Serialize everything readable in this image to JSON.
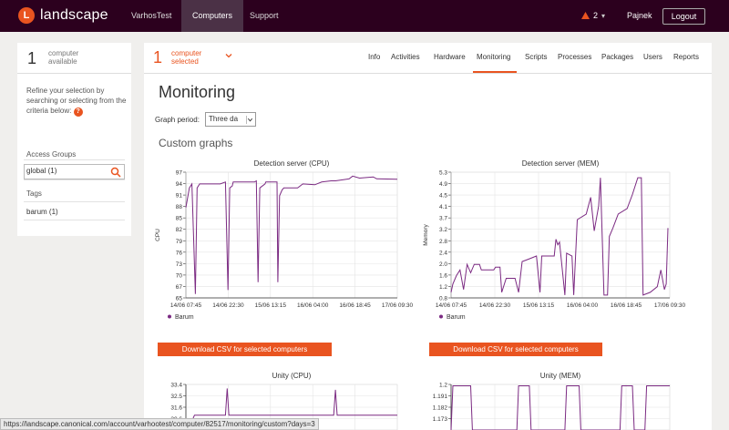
{
  "topbar": {
    "logo_letter": "L",
    "brand": "landscape",
    "nav": [
      "VarhosTest",
      "Computers",
      "Support"
    ],
    "alert_count": "2",
    "username": "Pajnek",
    "logout_label": "Logout"
  },
  "sidebar": {
    "count": "1",
    "count_label": "computer available",
    "hint": "Refine your selection by searching or selecting from the criteria below:",
    "search_placeholder": "",
    "access_groups_heading": "Access Groups",
    "access_groups": [
      "global (1)"
    ],
    "tags_heading": "Tags",
    "tags": [
      "barum (1)"
    ]
  },
  "main": {
    "selected_count": "1",
    "selected_label": "computer selected",
    "tabs": [
      "Info",
      "Activities",
      "Hardware",
      "Monitoring",
      "Scripts",
      "Processes",
      "Packages",
      "Users",
      "Reports"
    ],
    "title": "Monitoring",
    "graph_period_label": "Graph period:",
    "graph_period_value": "Three da",
    "custom_graphs_title": "Custom graphs",
    "csv_label": "Download CSV for selected computers"
  },
  "statusbar": "https://landscape.canonical.com/account/varhootest/computer/82517/monitoring/custom?days=3",
  "colors": {
    "accent": "#e95420",
    "topbar": "#2c001e",
    "series": "#7b2a82"
  },
  "chart_data": [
    {
      "type": "line",
      "title": "Detection server (CPU)",
      "ylabel": "CPU",
      "ylim": [
        65,
        97
      ],
      "yticks": [
        97,
        94,
        91,
        88,
        85,
        82,
        79,
        76,
        73,
        70,
        67,
        65
      ],
      "xticks": [
        "14/06 07:45",
        "14/06 22:30",
        "15/06 13:15",
        "16/06 04:00",
        "16/06 18:45",
        "17/06 09:30"
      ],
      "legend": [
        "Barum"
      ],
      "series": [
        {
          "name": "Barum",
          "points": [
            [
              0,
              88
            ],
            [
              0.2,
              93
            ],
            [
              0.35,
              94
            ],
            [
              0.55,
              66
            ],
            [
              0.65,
              93
            ],
            [
              0.8,
              94
            ],
            [
              2,
              94
            ],
            [
              2.3,
              94.5
            ],
            [
              2.45,
              67
            ],
            [
              2.55,
              93
            ],
            [
              2.7,
              93.5
            ],
            [
              2.75,
              94.5
            ],
            [
              4,
              94.5
            ],
            [
              4.1,
              94.8
            ],
            [
              4.2,
              69
            ],
            [
              4.3,
              93
            ],
            [
              4.6,
              94
            ],
            [
              4.65,
              94.5
            ],
            [
              5.3,
              94.5
            ],
            [
              5.35,
              69
            ],
            [
              5.45,
              91
            ],
            [
              5.6,
              92.5
            ],
            [
              5.7,
              93
            ],
            [
              6.5,
              93
            ],
            [
              6.8,
              94
            ],
            [
              7.5,
              93.8
            ],
            [
              7.9,
              94.5
            ],
            [
              8.45,
              94.8
            ],
            [
              8.7,
              94.8
            ],
            [
              9.5,
              95.3
            ],
            [
              9.7,
              96
            ],
            [
              10.1,
              95.5
            ],
            [
              10.9,
              95.8
            ],
            [
              11.1,
              95.3
            ],
            [
              12.3,
              95.2
            ]
          ]
        }
      ]
    },
    {
      "type": "line",
      "title": "Detection server (MEM)",
      "ylabel": "Memory",
      "ylim": [
        0.8,
        5.3
      ],
      "yticks": [
        "5.3",
        "4.9",
        "4.5",
        "4.1",
        "3.7",
        "3.2",
        "2.8",
        "2.4",
        "2.0",
        "1.6",
        "1.2",
        "0.8"
      ],
      "xticks": [
        "14/06 07:45",
        "14/06 22:30",
        "15/06 13:15",
        "16/06 04:00",
        "16/06 18:45",
        "17/06 09:30"
      ],
      "legend": [
        "Barum"
      ],
      "series": [
        {
          "name": "Barum",
          "points": [
            [
              0,
              1.0
            ],
            [
              0.1,
              1.3
            ],
            [
              0.3,
              1.6
            ],
            [
              0.5,
              1.8
            ],
            [
              0.7,
              1.1
            ],
            [
              0.9,
              2.0
            ],
            [
              1.1,
              1.7
            ],
            [
              1.3,
              2.0
            ],
            [
              1.6,
              2.0
            ],
            [
              1.7,
              1.8
            ],
            [
              2.0,
              1.8
            ],
            [
              2.4,
              1.8
            ],
            [
              2.5,
              1.9
            ],
            [
              2.75,
              1.9
            ],
            [
              2.85,
              1.0
            ],
            [
              3.1,
              1.5
            ],
            [
              3.6,
              1.5
            ],
            [
              3.8,
              1.0
            ],
            [
              4.0,
              2.1
            ],
            [
              4.4,
              2.2
            ],
            [
              4.8,
              2.3
            ],
            [
              5.0,
              1.0
            ],
            [
              5.1,
              2.3
            ],
            [
              5.8,
              2.3
            ],
            [
              5.9,
              2.9
            ],
            [
              6.0,
              2.7
            ],
            [
              6.1,
              2.8
            ],
            [
              6.4,
              0.9
            ],
            [
              6.5,
              2.4
            ],
            [
              6.8,
              2.3
            ],
            [
              6.9,
              0.9
            ],
            [
              7.1,
              3.6
            ],
            [
              7.6,
              3.8
            ],
            [
              7.85,
              4.4
            ],
            [
              8.05,
              3.2
            ],
            [
              8.3,
              4.1
            ],
            [
              8.4,
              5.1
            ],
            [
              8.6,
              0.9
            ],
            [
              8.8,
              0.9
            ],
            [
              8.9,
              3.0
            ],
            [
              9.1,
              3.3
            ],
            [
              9.4,
              3.8
            ],
            [
              9.9,
              4.0
            ],
            [
              10.2,
              4.5
            ],
            [
              10.5,
              5.1
            ],
            [
              10.7,
              5.1
            ],
            [
              10.8,
              0.9
            ],
            [
              11.2,
              1.0
            ],
            [
              11.6,
              1.2
            ],
            [
              11.8,
              1.8
            ],
            [
              12.0,
              1.1
            ],
            [
              12.1,
              1.3
            ],
            [
              12.2,
              3.3
            ]
          ]
        }
      ]
    },
    {
      "type": "line",
      "title": "Unity (CPU)",
      "yticks": [
        "33.4",
        "32.5",
        "31.6",
        "30.6"
      ],
      "ylim": [
        30.2,
        33.6
      ],
      "series": [
        {
          "name": "Barum",
          "points": [
            [
              0,
              31.0
            ],
            [
              0.4,
              31.0
            ],
            [
              0.5,
              31.3
            ],
            [
              2.3,
              31.3
            ],
            [
              2.4,
              33.3
            ],
            [
              2.5,
              31.3
            ],
            [
              8.6,
              31.3
            ],
            [
              8.7,
              33.2
            ],
            [
              8.8,
              31.3
            ],
            [
              12.3,
              31.3
            ]
          ]
        }
      ]
    },
    {
      "type": "line",
      "title": "Unity (MEM)",
      "yticks": [
        "1.2",
        "1.191",
        "1.182",
        "1.173"
      ],
      "ylim": [
        1.168,
        1.201
      ],
      "series": [
        {
          "name": "Barum",
          "points": [
            [
              0,
              1.168
            ],
            [
              0.1,
              1.2
            ],
            [
              1.1,
              1.2
            ],
            [
              1.2,
              1.168
            ],
            [
              3.7,
              1.168
            ],
            [
              3.8,
              1.2
            ],
            [
              4.4,
              1.2
            ],
            [
              4.5,
              1.168
            ],
            [
              6.4,
              1.168
            ],
            [
              6.5,
              1.2
            ],
            [
              7.2,
              1.2
            ],
            [
              7.3,
              1.168
            ],
            [
              9.5,
              1.168
            ],
            [
              9.6,
              1.2
            ],
            [
              10.2,
              1.2
            ],
            [
              10.3,
              1.168
            ],
            [
              10.9,
              1.168
            ],
            [
              11.0,
              1.2
            ],
            [
              12.3,
              1.2
            ]
          ]
        }
      ]
    }
  ]
}
